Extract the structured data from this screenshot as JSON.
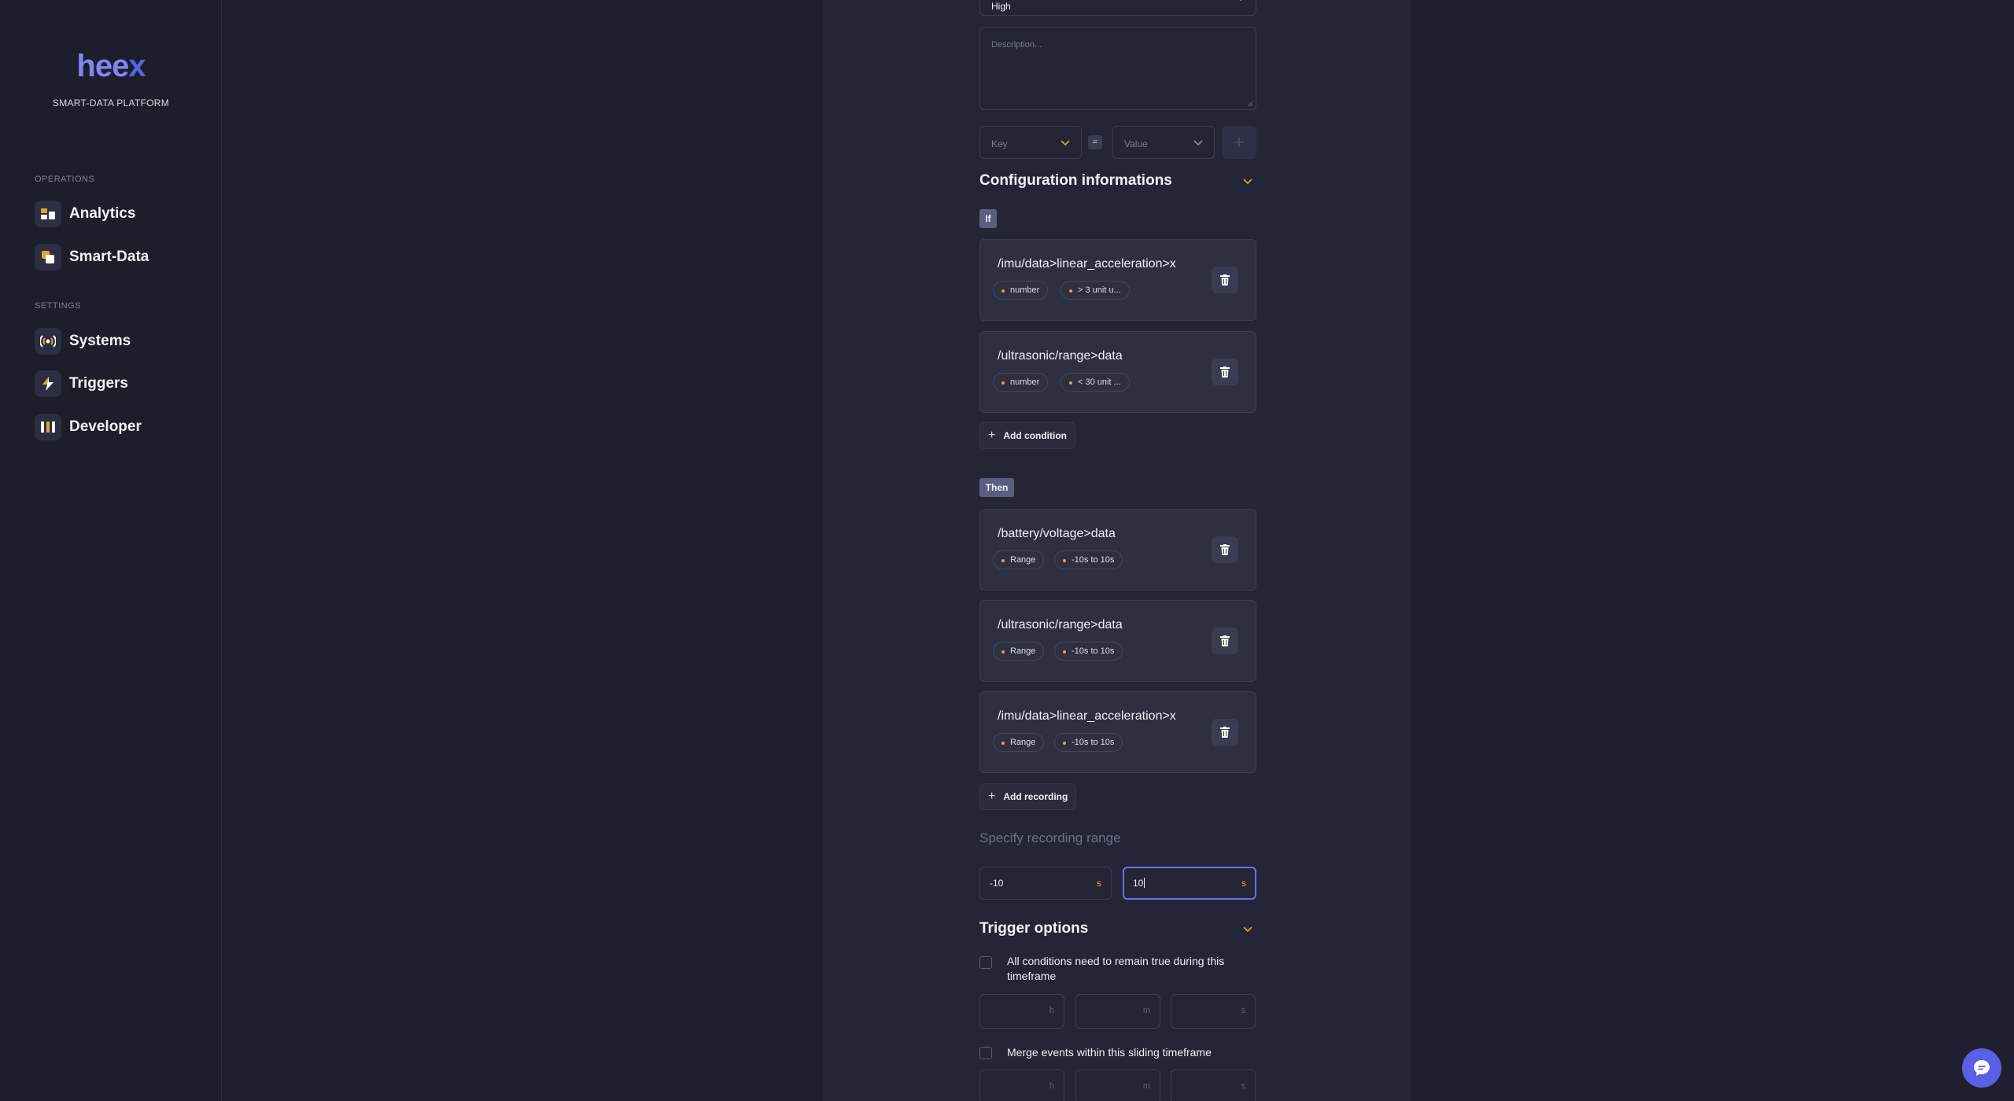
{
  "sidebar": {
    "logo_main": "hee",
    "logo_x": "x",
    "platform": "SMART-DATA PLATFORM",
    "operations_title": "OPERATIONS",
    "settings_title": "SETTINGS",
    "items": [
      {
        "label": "Analytics",
        "icon": "analytics-icon"
      },
      {
        "label": "Smart-Data",
        "icon": "smart-data-icon"
      },
      {
        "label": "Systems",
        "icon": "systems-icon"
      },
      {
        "label": "Triggers",
        "icon": "triggers-icon"
      },
      {
        "label": "Developer",
        "icon": "developer-icon"
      }
    ]
  },
  "form": {
    "priority_value": "High",
    "description_placeholder": "Description...",
    "key_placeholder": "Key",
    "equals": "=",
    "value_placeholder": "Value",
    "config_title": "Configuration informations",
    "if_tag": "If",
    "conditions": [
      {
        "title": "/imu/data>linear_acceleration>x",
        "type": "number",
        "rule": "> 3 unit u..."
      },
      {
        "title": "/ultrasonic/range>data",
        "type": "number",
        "rule": "< 30 unit ..."
      }
    ],
    "add_condition": "Add condition",
    "then_tag": "Then",
    "recordings": [
      {
        "title": "/battery/voltage>data",
        "type": "Range",
        "range": "-10s to 10s"
      },
      {
        "title": "/ultrasonic/range>data",
        "type": "Range",
        "range": "-10s to 10s"
      },
      {
        "title": "/imu/data>linear_acceleration>x",
        "type": "Range",
        "range": "-10s to 10s"
      }
    ],
    "add_recording": "Add recording",
    "recording_range_label": "Specify recording range",
    "range_start": "-10",
    "range_end": "10",
    "range_unit": "s",
    "trigger_options_title": "Trigger options",
    "option1": "All conditions need to remain true during this timeframe",
    "option2": "Merge events within this sliding timeframe",
    "unit_h": "h",
    "unit_m": "m",
    "unit_s": "s"
  },
  "colors": {
    "accent": "#e0a538",
    "brand": "#5a5fe6",
    "focus_border": "#6a70e8"
  }
}
